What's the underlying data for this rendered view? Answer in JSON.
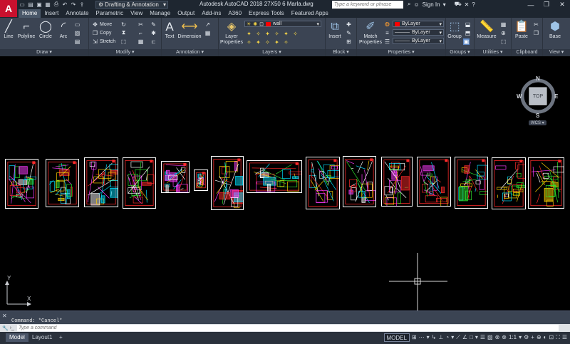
{
  "app": {
    "logo": "A",
    "workspace": "Drafting & Annotation",
    "title": "Autodesk AutoCAD 2018    27X50 6 Marla.dwg",
    "search_placeholder": "Type a keyword or phrase",
    "sign_in": "Sign In"
  },
  "qat_icons": [
    "new-icon",
    "open-icon",
    "save-icon",
    "saveas-icon",
    "print-icon",
    "undo-icon",
    "redo-icon",
    "share-icon"
  ],
  "tabs": [
    "Home",
    "Insert",
    "Annotate",
    "Parametric",
    "View",
    "Manage",
    "Output",
    "Add-ins",
    "A360",
    "Express Tools",
    "Featured Apps"
  ],
  "active_tab": "Home",
  "ribbon": {
    "draw": {
      "title": "Draw ▾",
      "line": "Line",
      "polyline": "Polyline",
      "circle": "Circle",
      "arc": "Arc"
    },
    "modify": {
      "title": "Modify ▾",
      "move": "Move",
      "copy": "Copy",
      "stretch": "Stretch"
    },
    "annotation": {
      "title": "Annotation ▾",
      "text": "Text",
      "dimension": "Dimension"
    },
    "layers": {
      "title": "Layers ▾",
      "layer_properties": "Layer\nProperties",
      "current_layer": "wall",
      "layer_color": "#ff0000"
    },
    "block": {
      "title": "Block ▾",
      "insert": "Insert"
    },
    "properties": {
      "title": "Properties ▾",
      "match": "Match\nProperties",
      "color": "ByLayer",
      "linetype": "ByLayer",
      "lineweight": "ByLayer"
    },
    "groups": {
      "title": "Groups ▾",
      "group": "Group"
    },
    "utilities": {
      "title": "Utilities ▾",
      "measure": "Measure"
    },
    "clipboard": {
      "title": "Clipboard",
      "paste": "Paste"
    },
    "view": {
      "title": "View ▾",
      "base": "Base"
    }
  },
  "viewcube": {
    "n": "N",
    "s": "S",
    "e": "E",
    "w": "W",
    "top": "TOP",
    "wcs": "WCS ▾"
  },
  "ucs": {
    "x": "X",
    "y": "Y"
  },
  "sheets": [
    "sheet-1",
    "sheet-2",
    "sheet-3",
    "sheet-4",
    "sheet-5",
    "sheet-6",
    "sheet-7",
    "sheet-8",
    "sheet-9",
    "sheet-10",
    "sheet-11",
    "sheet-12",
    "sheet-13",
    "sheet-14",
    "sheet-15"
  ],
  "command": {
    "history": "Command: *Cancel*",
    "placeholder": "Type a command"
  },
  "status": {
    "tabs": [
      "Model",
      "Layout1"
    ],
    "active": "Model",
    "add": "+",
    "model": "MODEL",
    "scale": "1:1"
  }
}
